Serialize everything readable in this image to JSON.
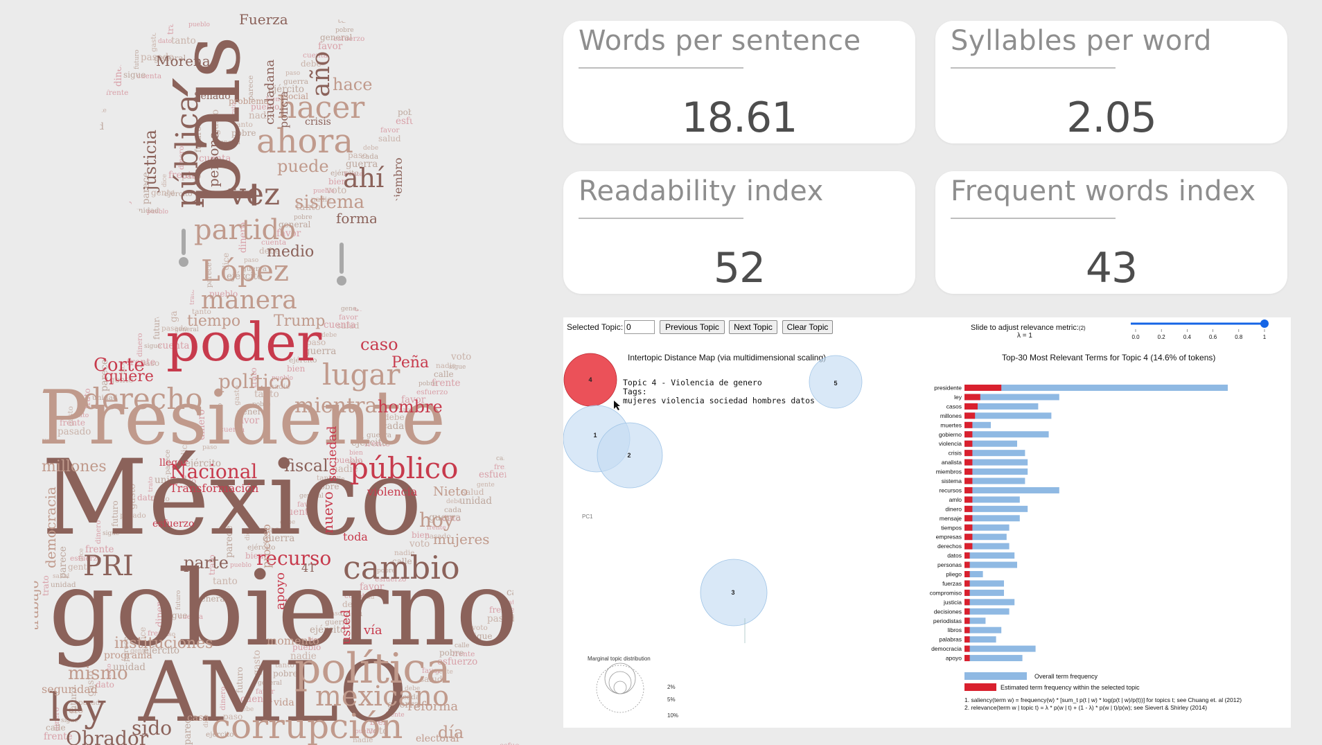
{
  "metrics": [
    {
      "title": "Words per sentence",
      "value": "18.61"
    },
    {
      "title": "Syllables per word",
      "value": "2.05"
    },
    {
      "title": "Readability index",
      "value": "52"
    },
    {
      "title": "Frequent words index",
      "value": "43"
    }
  ],
  "wordcloud": {
    "words": [
      {
        "text": "México",
        "w": "xl",
        "c": "brown"
      },
      {
        "text": "gobierno",
        "w": "xl",
        "c": "brown"
      },
      {
        "text": "Presidente",
        "w": "xl",
        "c": "tan"
      },
      {
        "text": "AMLO",
        "w": "xl",
        "c": "brown"
      },
      {
        "text": "país",
        "w": "xl",
        "c": "brown"
      },
      {
        "text": "poder",
        "w": "l",
        "c": "red"
      },
      {
        "text": "política",
        "w": "l",
        "c": "tan"
      },
      {
        "text": "corrupción",
        "w": "l",
        "c": "tan"
      },
      {
        "text": "cambio",
        "w": "l",
        "c": "brown"
      },
      {
        "text": "mexicano",
        "w": "l",
        "c": "tan"
      },
      {
        "text": "ley",
        "w": "l",
        "c": "brown"
      },
      {
        "text": "público",
        "w": "l",
        "c": "red"
      },
      {
        "text": "derecho",
        "w": "l",
        "c": "tan"
      },
      {
        "text": "lugar",
        "w": "l",
        "c": "tan"
      },
      {
        "text": "ahora",
        "w": "l",
        "c": "tan"
      },
      {
        "text": "hacer",
        "w": "l",
        "c": "tan"
      },
      {
        "text": "pública",
        "w": "l",
        "c": "brown"
      },
      {
        "text": "vez",
        "w": "l",
        "c": "brown"
      },
      {
        "text": "López",
        "w": "l",
        "c": "tan"
      },
      {
        "text": "partido",
        "w": "l",
        "c": "tan"
      },
      {
        "text": "manera",
        "w": "l",
        "c": "tan"
      },
      {
        "text": "Nacional",
        "w": "m",
        "c": "red"
      },
      {
        "text": "Corte",
        "w": "m",
        "c": "red"
      },
      {
        "text": "caso",
        "w": "m",
        "c": "red"
      },
      {
        "text": "Peña",
        "w": "m",
        "c": "red"
      },
      {
        "text": "hombre",
        "w": "m",
        "c": "red"
      },
      {
        "text": "político",
        "w": "m",
        "c": "tan"
      },
      {
        "text": "mientra",
        "w": "m",
        "c": "tan"
      },
      {
        "text": "quiere",
        "w": "m",
        "c": "red"
      },
      {
        "text": "fiscal",
        "w": "m",
        "c": "brown"
      },
      {
        "text": "PRI",
        "w": "m",
        "c": "brown"
      },
      {
        "text": "sido",
        "w": "m",
        "c": "brown"
      },
      {
        "text": "Obrador",
        "w": "m",
        "c": "brown"
      },
      {
        "text": "mismo",
        "w": "m",
        "c": "tan"
      },
      {
        "text": "hoy",
        "w": "m",
        "c": "tan"
      },
      {
        "text": "parte",
        "w": "m",
        "c": "brown"
      },
      {
        "text": "recurso",
        "w": "m",
        "c": "red"
      },
      {
        "text": "instituciones",
        "w": "m",
        "c": "tan"
      },
      {
        "text": "día",
        "w": "m",
        "c": "tan"
      },
      {
        "text": "sistema",
        "w": "m",
        "c": "tan"
      },
      {
        "text": "ahí",
        "w": "m",
        "c": "brown"
      },
      {
        "text": "puede",
        "w": "m",
        "c": "tan"
      },
      {
        "text": "año",
        "w": "m",
        "c": "brown"
      },
      {
        "text": "hace",
        "w": "m",
        "c": "tan"
      },
      {
        "text": "forma",
        "w": "s",
        "c": "brown"
      },
      {
        "text": "medio",
        "w": "s",
        "c": "brown"
      },
      {
        "text": "tiempo",
        "w": "s",
        "c": "tan"
      },
      {
        "text": "Trump",
        "w": "s",
        "c": "tan"
      },
      {
        "text": "justicia",
        "w": "s",
        "c": "brown"
      },
      {
        "text": "persona",
        "w": "s",
        "c": "brown"
      },
      {
        "text": "Morena",
        "w": "s",
        "c": "brown"
      },
      {
        "text": "Fuerza",
        "w": "s",
        "c": "brown"
      },
      {
        "text": "ciudadana",
        "w": "s",
        "c": "brown"
      },
      {
        "text": "policía",
        "w": "s",
        "c": "brown"
      },
      {
        "text": "miembro",
        "w": "s",
        "c": "brown"
      },
      {
        "text": "millones",
        "w": "s",
        "c": "tan"
      },
      {
        "text": "democracia",
        "w": "s",
        "c": "tan"
      },
      {
        "text": "trabajo",
        "w": "s",
        "c": "tan"
      },
      {
        "text": "mujeres",
        "w": "s",
        "c": "tan"
      },
      {
        "text": "Nieto",
        "w": "s",
        "c": "tan"
      },
      {
        "text": "violencia",
        "w": "s",
        "c": "red"
      },
      {
        "text": "Transformación",
        "w": "s",
        "c": "red"
      },
      {
        "text": "nuevo",
        "w": "s",
        "c": "red"
      },
      {
        "text": "sociedad",
        "w": "s",
        "c": "red"
      },
      {
        "text": "usted",
        "w": "s",
        "c": "red"
      },
      {
        "text": "vía",
        "w": "s",
        "c": "red"
      },
      {
        "text": "apoyo",
        "w": "s",
        "c": "red"
      },
      {
        "text": "reforma",
        "w": "s",
        "c": "tan"
      },
      {
        "text": "seguridad",
        "w": "s",
        "c": "tan"
      },
      {
        "text": "momento",
        "w": "s",
        "c": "tan"
      },
      {
        "text": "toda",
        "w": "s",
        "c": "red"
      },
      {
        "text": "proceso",
        "w": "s",
        "c": "tan"
      },
      {
        "text": "llegar",
        "w": "s",
        "c": "red"
      },
      {
        "text": "esfuerzo",
        "w": "s",
        "c": "red"
      },
      {
        "text": "4T",
        "w": "s",
        "c": "brown"
      },
      {
        "text": "programa",
        "w": "s",
        "c": "tan"
      },
      {
        "text": "casa",
        "w": "s",
        "c": "tan"
      },
      {
        "text": "vida",
        "w": "s",
        "c": "tan"
      },
      {
        "text": "electoral",
        "w": "s",
        "c": "tan"
      },
      {
        "text": "problema",
        "w": "s",
        "c": "tan"
      },
      {
        "text": "Senado",
        "w": "s",
        "c": "brown"
      },
      {
        "text": "crisis",
        "w": "s",
        "c": "brown"
      },
      {
        "text": "social",
        "w": "s",
        "c": "tan"
      },
      {
        "text": "Gracia",
        "w": "s",
        "c": "tan"
      }
    ]
  },
  "ldavis": {
    "toolbar": {
      "selected_topic_label": "Selected Topic:",
      "selected_topic_value": "0",
      "prev_label": "Previous Topic",
      "next_label": "Next Topic",
      "clear_label": "Clear Topic",
      "slider_label": "Slide to adjust relevance metric:",
      "slider_note": "(2)",
      "lambda_label": "λ = 1",
      "slider_value": 1,
      "slider_ticks": [
        "0.0",
        "0.2",
        "0.4",
        "0.6",
        "0.8",
        "1"
      ]
    },
    "map_title": "Intertopic Distance Map (via multidimensional scaling)",
    "bars_title": "Top-30 Most Relevant Terms for Topic 4 (14.6% of tokens)",
    "tooltip": {
      "line1": "Topic 4 - Violencia de genero",
      "line2": "Tags:",
      "line3": "mujeres violencia sociedad hombres datos"
    },
    "pc1_label": "PC1",
    "topics": [
      {
        "id": "4",
        "selected": true
      },
      {
        "id": "1",
        "selected": false
      },
      {
        "id": "2",
        "selected": false
      },
      {
        "id": "5",
        "selected": false
      },
      {
        "id": "3",
        "selected": false
      }
    ],
    "marginal": {
      "title": "Marginal topic distribution",
      "ticks": [
        "2%",
        "5%",
        "10%"
      ]
    },
    "legend": {
      "overall": "Overall term frequency",
      "estimated": "Estimated term frequency within the selected topic",
      "note1": "1. saliency(term w) = frequency(w) * [sum_t p(t | w) * log(p(t | w)/p(t))] for topics t; see Chuang et. al (2012)",
      "note2": "2. relevance(term w | topic t) = λ * p(w | t) + (1 - λ) * p(w | t)/p(w); see Sievert & Shirley (2014)"
    },
    "colors": {
      "overall": "#8fb9e3",
      "estimated": "#d9202e",
      "topic_selected": "#e8323c",
      "topic": "#c4dcf2"
    }
  },
  "chart_data": {
    "type": "bar",
    "title": "Top-30 Most Relevant Terms for Topic 4 (14.6% of tokens)",
    "categories": [
      "presidente",
      "ley",
      "casos",
      "millones",
      "muertes",
      "gobierno",
      "violencia",
      "crisis",
      "analista",
      "miembros",
      "sistema",
      "recursos",
      "amlo",
      "dinero",
      "mensaje",
      "tiempos",
      "empresas",
      "derechos",
      "datos",
      "personas",
      "pliego",
      "fuerzas",
      "compromiso",
      "justicia",
      "decisiones",
      "periodistas",
      "libros",
      "palabras",
      "democracia",
      "apoyo"
    ],
    "series": [
      {
        "name": "Overall term frequency",
        "values": [
          100,
          36,
          28,
          33,
          10,
          32,
          20,
          23,
          24,
          24,
          23,
          36,
          21,
          24,
          21,
          17,
          16,
          17,
          19,
          20,
          7,
          15,
          15,
          19,
          17,
          8,
          14,
          12,
          27,
          22
        ]
      },
      {
        "name": "Estimated term frequency within the selected topic",
        "values": [
          14,
          6,
          5,
          4,
          3,
          3,
          3,
          3,
          3,
          3,
          3,
          3,
          3,
          3,
          3,
          3,
          3,
          3,
          2,
          2,
          2,
          2,
          2,
          2,
          2,
          2,
          2,
          2,
          2,
          2
        ]
      }
    ]
  }
}
